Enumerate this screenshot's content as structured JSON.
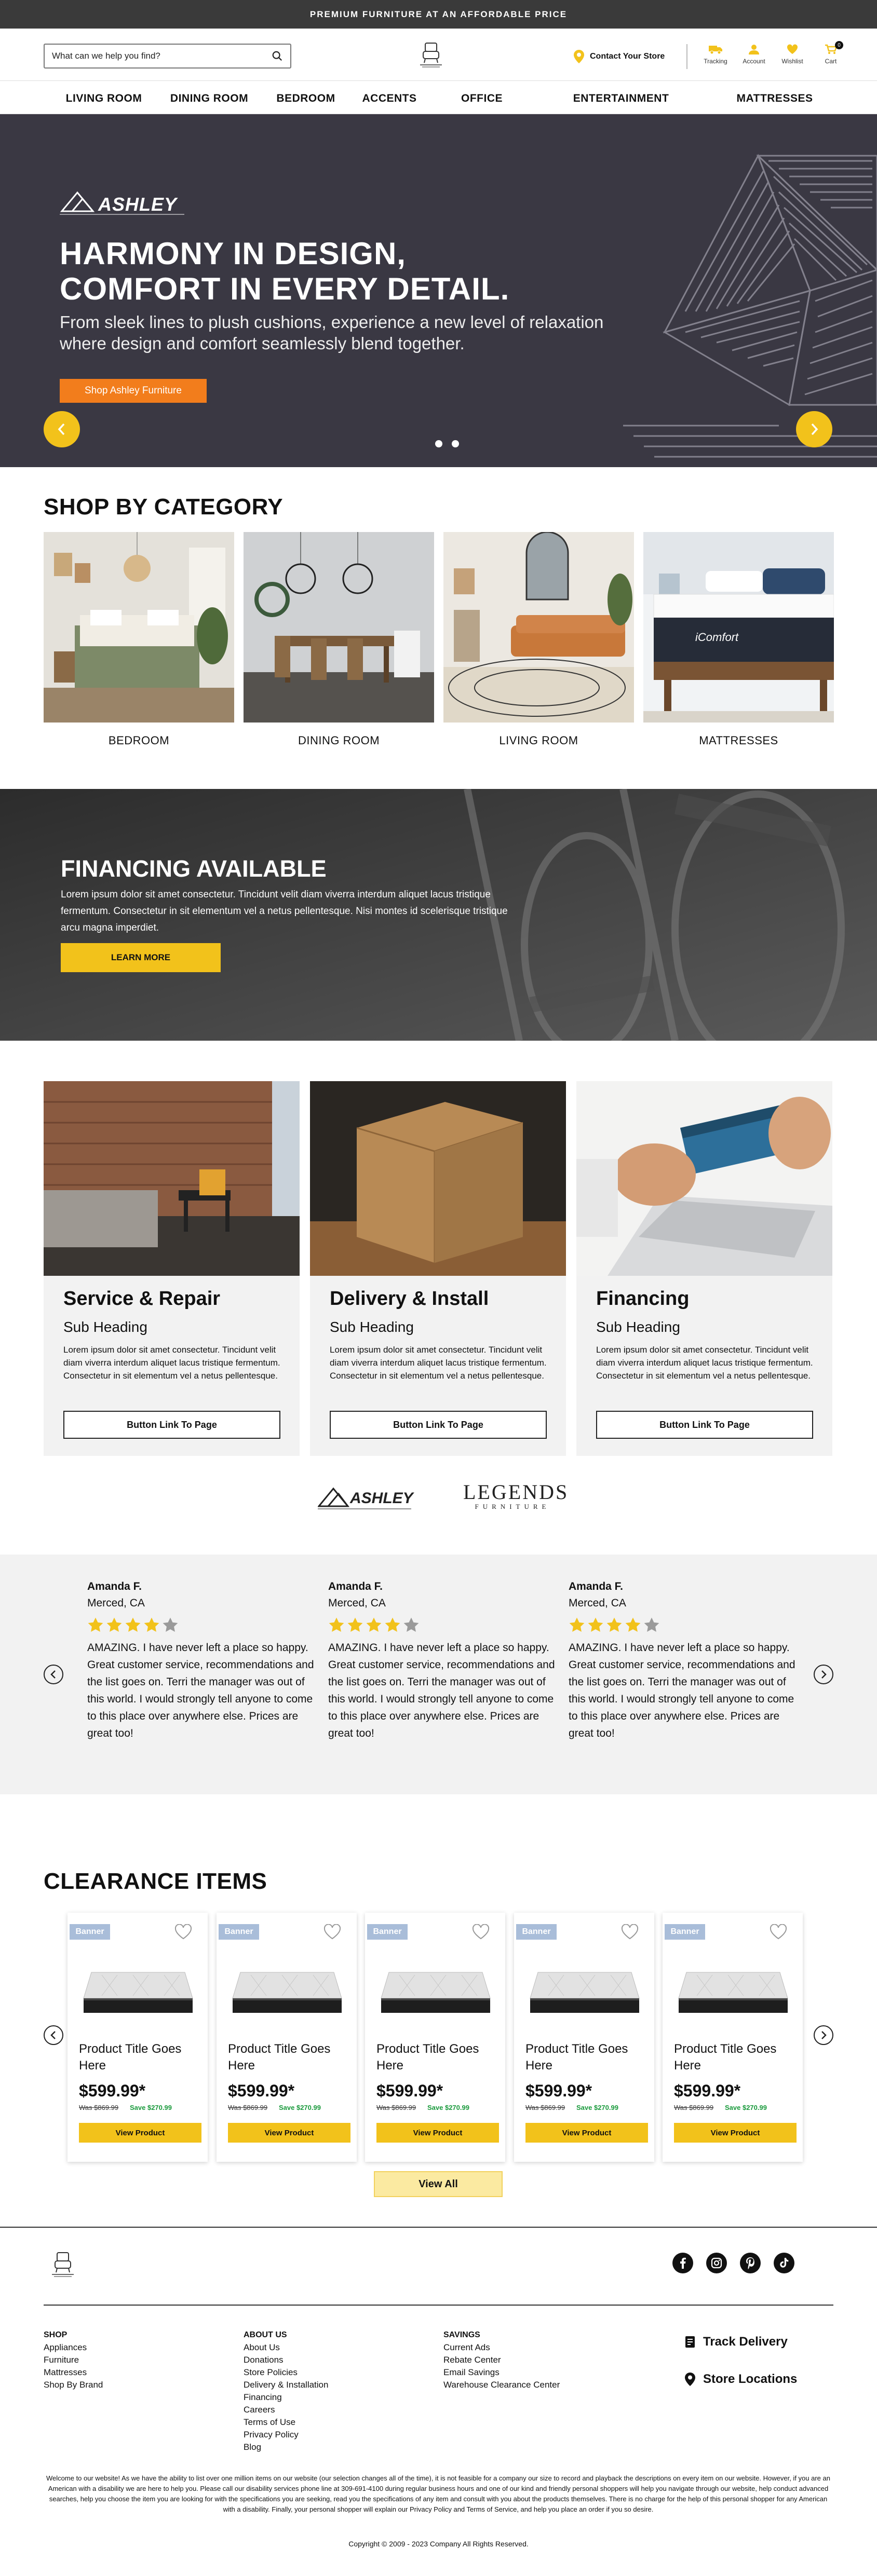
{
  "topbar": {
    "text": "PREMIUM FURNITURE AT AN AFFORDABLE PRICE"
  },
  "header": {
    "search_placeholder": "What can we help you find?",
    "contact_label": "Contact Your Store",
    "icons": [
      {
        "label": "Tracking",
        "icon": "truck-icon"
      },
      {
        "label": "Account",
        "icon": "account-icon"
      },
      {
        "label": "Wishlist",
        "icon": "heart-icon"
      },
      {
        "label": "Cart",
        "icon": "cart-icon"
      }
    ],
    "cart_count": "0"
  },
  "nav": [
    "LIVING ROOM",
    "DINING ROOM",
    "BEDROOM",
    "ACCENTS",
    "OFFICE",
    "ENTERTAINMENT",
    "MATTRESSES"
  ],
  "hero": {
    "brand": "ASHLEY",
    "title_line1": "HARMONY IN DESIGN,",
    "title_line2": "COMFORT IN EVERY DETAIL.",
    "text": "From sleek lines to plush cushions, experience a new level of relaxation where design and comfort seamlessly blend together.",
    "cta": "Shop Ashley Furniture"
  },
  "categories": {
    "heading": "SHOP BY CATEGORY",
    "items": [
      "BEDROOM",
      "DINING ROOM",
      "LIVING ROOM",
      "MATTRESSES"
    ],
    "mattress_brand": "iComfort"
  },
  "financing": {
    "title": "FINANCING AVAILABLE",
    "text": "Lorem ipsum dolor sit amet consectetur. Tincidunt velit diam viverra interdum aliquet lacus tristique fermentum. Consectetur in sit elementum vel a netus pellentesque. Nisi montes id scelerisque tristique arcu magna imperdiet.",
    "button": "LEARN MORE"
  },
  "services": [
    {
      "title": "Service & Repair",
      "sub": "Sub Heading",
      "text": "Lorem ipsum dolor sit amet consectetur. Tincidunt velit diam viverra interdum aliquet lacus tristique fermentum. Consectetur in sit elementum vel a netus pellentesque.",
      "button": "Button Link To Page"
    },
    {
      "title": "Delivery & Install",
      "sub": "Sub Heading",
      "text": "Lorem ipsum dolor sit amet consectetur. Tincidunt velit diam viverra interdum aliquet lacus tristique fermentum. Consectetur in sit elementum vel a netus pellentesque.",
      "button": "Button Link To Page"
    },
    {
      "title": "Financing",
      "sub": "Sub Heading",
      "text": "Lorem ipsum dolor sit amet consectetur. Tincidunt velit diam viverra interdum aliquet lacus tristique fermentum. Consectetur in sit elementum vel a netus pellentesque.",
      "button": "Button Link To Page"
    }
  ],
  "brands": {
    "ashley": "ASHLEY",
    "legends": "LEGENDS",
    "legends_sub": "FURNITURE"
  },
  "reviews": [
    {
      "name": "Amanda F.",
      "location": "Merced, CA",
      "rating": 4,
      "text": "AMAZING. I have never left a place so happy. Great customer service, recommendations and the list goes on. Terri the manager was out of this world. I would strongly tell anyone to come to this place over anywhere else. Prices are great too!"
    },
    {
      "name": "Amanda F.",
      "location": "Merced, CA",
      "rating": 4,
      "text": "AMAZING. I have never left a place so happy. Great customer service, recommendations and the list goes on. Terri the manager was out of this world. I would strongly tell anyone to come to this place over anywhere else. Prices are great too!"
    },
    {
      "name": "Amanda F.",
      "location": "Merced, CA",
      "rating": 4,
      "text": "AMAZING. I have never left a place so happy. Great customer service, recommendations and the list goes on. Terri the manager was out of this world. I would strongly tell anyone to come to this place over anywhere else. Prices are great too!"
    }
  ],
  "clearance": {
    "heading": "CLEARANCE ITEMS",
    "products": [
      {
        "badge": "Banner",
        "title": "Product Title Goes Here",
        "price": "$599.99*",
        "was": "Was $869.99",
        "save": "Save $270.99",
        "button": "View Product"
      },
      {
        "badge": "Banner",
        "title": "Product Title Goes Here",
        "price": "$599.99*",
        "was": "Was $869.99",
        "save": "Save $270.99",
        "button": "View Product"
      },
      {
        "badge": "Banner",
        "title": "Product Title Goes Here",
        "price": "$599.99*",
        "was": "Was $869.99",
        "save": "Save $270.99",
        "button": "View Product"
      },
      {
        "badge": "Banner",
        "title": "Product Title Goes Here",
        "price": "$599.99*",
        "was": "Was $869.99",
        "save": "Save $270.99",
        "button": "View Product"
      },
      {
        "badge": "Banner",
        "title": "Product Title Goes Here",
        "price": "$599.99*",
        "was": "Was $869.99",
        "save": "Save $270.99",
        "button": "View Product"
      }
    ],
    "view_all": "View All"
  },
  "footer": {
    "social": [
      "facebook-icon",
      "instagram-icon",
      "pinterest-icon",
      "tiktok-icon"
    ],
    "columns": [
      {
        "heading": "SHOP",
        "links": [
          "Appliances",
          "Furniture",
          "Mattresses",
          "Shop By Brand"
        ]
      },
      {
        "heading": "ABOUT US",
        "links": [
          "About Us",
          "Donations",
          "Store Policies",
          "Delivery & Installation",
          "Financing",
          "Careers",
          "Terms of Use",
          "Privacy Policy",
          "Blog"
        ]
      },
      {
        "heading": "SAVINGS",
        "links": [
          "Current Ads",
          "Rebate Center",
          "Email Savings",
          "Warehouse Clearance Center"
        ]
      }
    ],
    "track_delivery": "Track Delivery",
    "store_locations": "Store Locations",
    "disclaimer": "Welcome to our website! As we have the ability to list over one million items on our website (our selection changes all of the time), it is not feasible for a company our size to record and playback the descriptions on every item on our website. However, if you are an American with a disability we are here to help you. Please call our disability services phone line at 309-691-4100 during regular business hours and one of our kind and friendly personal shoppers will help you navigate through our website, help conduct advanced searches, help you choose the item you are looking for with the specifications you are seeking, read you the specifications of any item and consult with you about the products themselves. There is no charge for the help of this personal shopper for any American with a disability. Finally, your personal shopper will explain our Privacy Policy and Terms of Service, and help you place an order if you so desire.",
    "copyright": "Copyright © 2009 - 2023 Company All Rights Reserved."
  }
}
